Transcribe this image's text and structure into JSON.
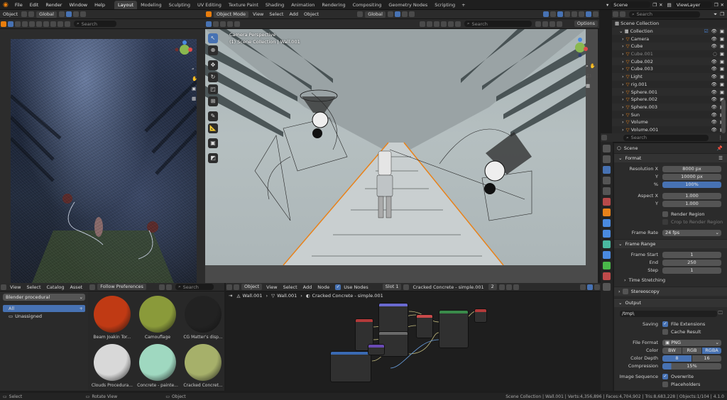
{
  "menu": [
    "File",
    "Edit",
    "Render",
    "Window",
    "Help"
  ],
  "workspace_tabs": [
    "Layout",
    "Modeling",
    "Sculpting",
    "UV Editing",
    "Texture Paint",
    "Shading",
    "Animation",
    "Rendering",
    "Compositing",
    "Geometry Nodes",
    "Scripting"
  ],
  "active_tab": "Layout",
  "scene_name": "Scene",
  "view_layer": "ViewLayer",
  "left_header": {
    "mode": "Object",
    "transform": "Global"
  },
  "left_toolbar": {
    "search_placeholder": "Search"
  },
  "viewport": {
    "mode": "Object Mode",
    "menus": [
      "View",
      "Select",
      "Add",
      "Object"
    ],
    "transform": "Global",
    "search_placeholder": "Search",
    "options": "Options",
    "overlay_title": "Camera Perspective",
    "overlay_subtitle": "(1) Scene Collection | Wall.001"
  },
  "outliner": {
    "search_placeholder": "Search",
    "root": "Scene Collection",
    "collection": "Collection",
    "items": [
      "Camera",
      "Cube",
      "Cube.001",
      "Cube.002",
      "Cube.003",
      "Light",
      "rig.001",
      "Sphere.001",
      "Sphere.002",
      "Sphere.003",
      "Sun",
      "Volume",
      "Volume.001"
    ]
  },
  "properties": {
    "search_placeholder": "Search",
    "context": "Scene",
    "format": {
      "title": "Format",
      "resolution_x_label": "Resolution X",
      "resolution_x": "8000 px",
      "y_label": "Y",
      "resolution_y": "10000 px",
      "percent_label": "%",
      "percent": "100%",
      "aspect_x_label": "Aspect X",
      "aspect_x": "1.000",
      "aspect_y_label": "Y",
      "aspect_y": "1.000",
      "render_region": "Render Region",
      "crop": "Crop to Render Region",
      "frame_rate_label": "Frame Rate",
      "frame_rate": "24 fps"
    },
    "frame_range": {
      "title": "Frame Range",
      "start_label": "Frame Start",
      "start": "1",
      "end_label": "End",
      "end": "250",
      "step_label": "Step",
      "step": "1"
    },
    "time_stretching": "Time Stretching",
    "stereoscopy": "Stereoscopy",
    "output": {
      "title": "Output",
      "path": "/tmp\\",
      "saving_label": "Saving",
      "file_extensions": "File Extensions",
      "cache_result": "Cache Result",
      "file_format_label": "File Format",
      "file_format": "PNG",
      "color_label": "Color",
      "color_options": [
        "BW",
        "RGB",
        "RGBA"
      ],
      "color_selected": "RGBA",
      "depth_label": "Color Depth",
      "depth_options": [
        "8",
        "16"
      ],
      "depth_selected": "8",
      "compression_label": "Compression",
      "compression": "15%",
      "image_sequence_label": "Image Sequence",
      "overwrite": "Overwrite",
      "placeholders": "Placeholders"
    }
  },
  "asset_browser": {
    "menus": [
      "View",
      "Select",
      "Catalog",
      "Asset"
    ],
    "preference": "Follow Preferences",
    "search_placeholder": "Search",
    "library": "Blender procedural",
    "catalogs": [
      "All",
      "Unassigned"
    ],
    "assets": [
      {
        "name": "Beam Joakin Tor...",
        "color": "#c03a14"
      },
      {
        "name": "Camouflage",
        "color": "#8a9a3a"
      },
      {
        "name": "CG Matter's disp...",
        "color": "#222222"
      },
      {
        "name": "Clouds Procedura...",
        "color": "#d8d8d8"
      },
      {
        "name": "Concrete - painte...",
        "color": "#9fd8c0"
      },
      {
        "name": "Cracked Concret...",
        "color": "#a6b06a"
      }
    ]
  },
  "node_editor": {
    "type": "Object",
    "menus": [
      "View",
      "Select",
      "Add",
      "Node"
    ],
    "use_nodes": "Use Nodes",
    "slot": "Slot 1",
    "material": "Cracked Concrete - simple.001",
    "users": "2",
    "breadcrumb": [
      "Wall.001",
      "Wall.001",
      "Cracked Concrete - simple.001"
    ]
  },
  "status": {
    "left": [
      "Select",
      "Rotate View",
      "Object"
    ],
    "right": "Scene Collection | Wall.001 | Verts:4,356,896 | Faces:4,704,902 | Tris:8,683,228 | Objects:1/104 | 4.1.0"
  }
}
